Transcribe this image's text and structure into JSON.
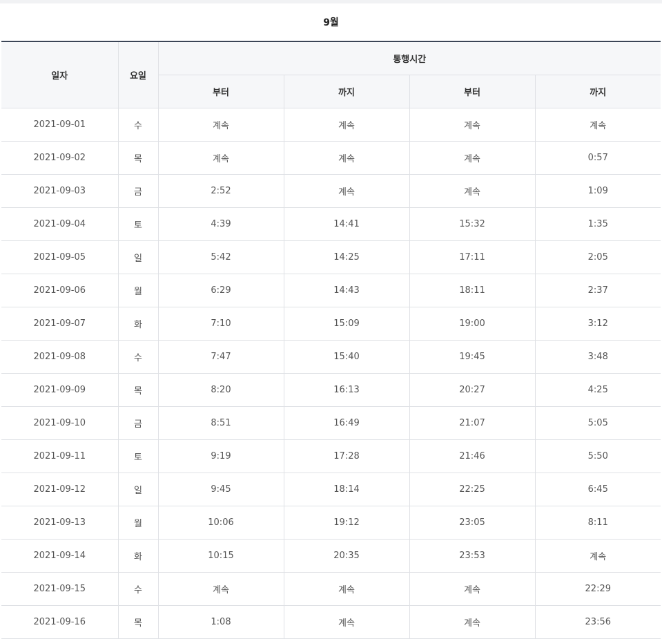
{
  "month_title": "9월",
  "headers": {
    "date": "일자",
    "weekday": "요일",
    "passage": "통행시간",
    "from1": "부터",
    "to1": "까지",
    "from2": "부터",
    "to2": "까지"
  },
  "rows": [
    {
      "date": "2021-09-01",
      "weekday": "수",
      "from1": "계속",
      "to1": "계속",
      "from2": "계속",
      "to2": "계속"
    },
    {
      "date": "2021-09-02",
      "weekday": "목",
      "from1": "계속",
      "to1": "계속",
      "from2": "계속",
      "to2": "0:57"
    },
    {
      "date": "2021-09-03",
      "weekday": "금",
      "from1": "2:52",
      "to1": "계속",
      "from2": "계속",
      "to2": "1:09"
    },
    {
      "date": "2021-09-04",
      "weekday": "토",
      "from1": "4:39",
      "to1": "14:41",
      "from2": "15:32",
      "to2": "1:35"
    },
    {
      "date": "2021-09-05",
      "weekday": "일",
      "from1": "5:42",
      "to1": "14:25",
      "from2": "17:11",
      "to2": "2:05"
    },
    {
      "date": "2021-09-06",
      "weekday": "월",
      "from1": "6:29",
      "to1": "14:43",
      "from2": "18:11",
      "to2": "2:37"
    },
    {
      "date": "2021-09-07",
      "weekday": "화",
      "from1": "7:10",
      "to1": "15:09",
      "from2": "19:00",
      "to2": "3:12"
    },
    {
      "date": "2021-09-08",
      "weekday": "수",
      "from1": "7:47",
      "to1": "15:40",
      "from2": "19:45",
      "to2": "3:48"
    },
    {
      "date": "2021-09-09",
      "weekday": "목",
      "from1": "8:20",
      "to1": "16:13",
      "from2": "20:27",
      "to2": "4:25"
    },
    {
      "date": "2021-09-10",
      "weekday": "금",
      "from1": "8:51",
      "to1": "16:49",
      "from2": "21:07",
      "to2": "5:05"
    },
    {
      "date": "2021-09-11",
      "weekday": "토",
      "from1": "9:19",
      "to1": "17:28",
      "from2": "21:46",
      "to2": "5:50"
    },
    {
      "date": "2021-09-12",
      "weekday": "일",
      "from1": "9:45",
      "to1": "18:14",
      "from2": "22:25",
      "to2": "6:45"
    },
    {
      "date": "2021-09-13",
      "weekday": "월",
      "from1": "10:06",
      "to1": "19:12",
      "from2": "23:05",
      "to2": "8:11"
    },
    {
      "date": "2021-09-14",
      "weekday": "화",
      "from1": "10:15",
      "to1": "20:35",
      "from2": "23:53",
      "to2": "계속"
    },
    {
      "date": "2021-09-15",
      "weekday": "수",
      "from1": "계속",
      "to1": "계속",
      "from2": "계속",
      "to2": "22:29"
    },
    {
      "date": "2021-09-16",
      "weekday": "목",
      "from1": "1:08",
      "to1": "계속",
      "from2": "계속",
      "to2": "23:56"
    }
  ]
}
